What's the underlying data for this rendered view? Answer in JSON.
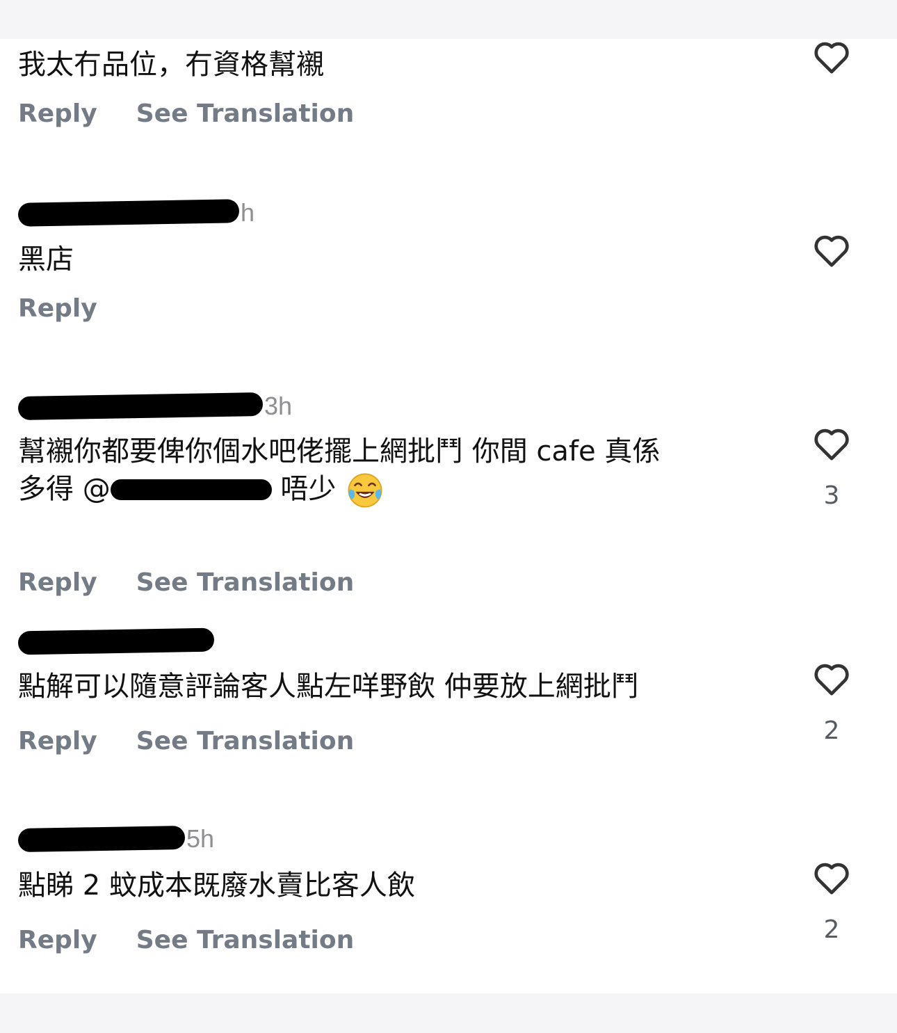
{
  "comments": [
    {
      "author_time": "",
      "text": "我太冇品位，冇資格幫襯",
      "reply_label": "Reply",
      "translate_label": "See Translation",
      "likes": ""
    },
    {
      "author_time": "h",
      "text": "黑店",
      "reply_label": "Reply",
      "translate_label": "",
      "likes": ""
    },
    {
      "author_time": "3h",
      "text_line1": "幫襯你都要俾你個水吧佬擺上網批鬥 你間 cafe 真係",
      "text_line2_pre": "多得 @",
      "text_line2_post": " 唔少",
      "emoji": "face-with-tears-of-joy",
      "reply_label": "Reply",
      "translate_label": "See Translation",
      "likes": "3"
    },
    {
      "author_time": "",
      "text": "點解可以隨意評論客人點左咩野飲 仲要放上網批鬥",
      "reply_label": "Reply",
      "translate_label": "See Translation",
      "likes": "2"
    },
    {
      "author_time": "5h",
      "text": "點睇 2 蚊成本既廢水賣比客人飲",
      "reply_label": "Reply",
      "translate_label": "See Translation",
      "likes": "2"
    }
  ],
  "icons": {
    "like": "heart-outline-icon"
  },
  "colors": {
    "background": "#ffffff",
    "page_edges": "#f5f5f7",
    "action_text": "#737b86",
    "count_text": "#555b63"
  }
}
